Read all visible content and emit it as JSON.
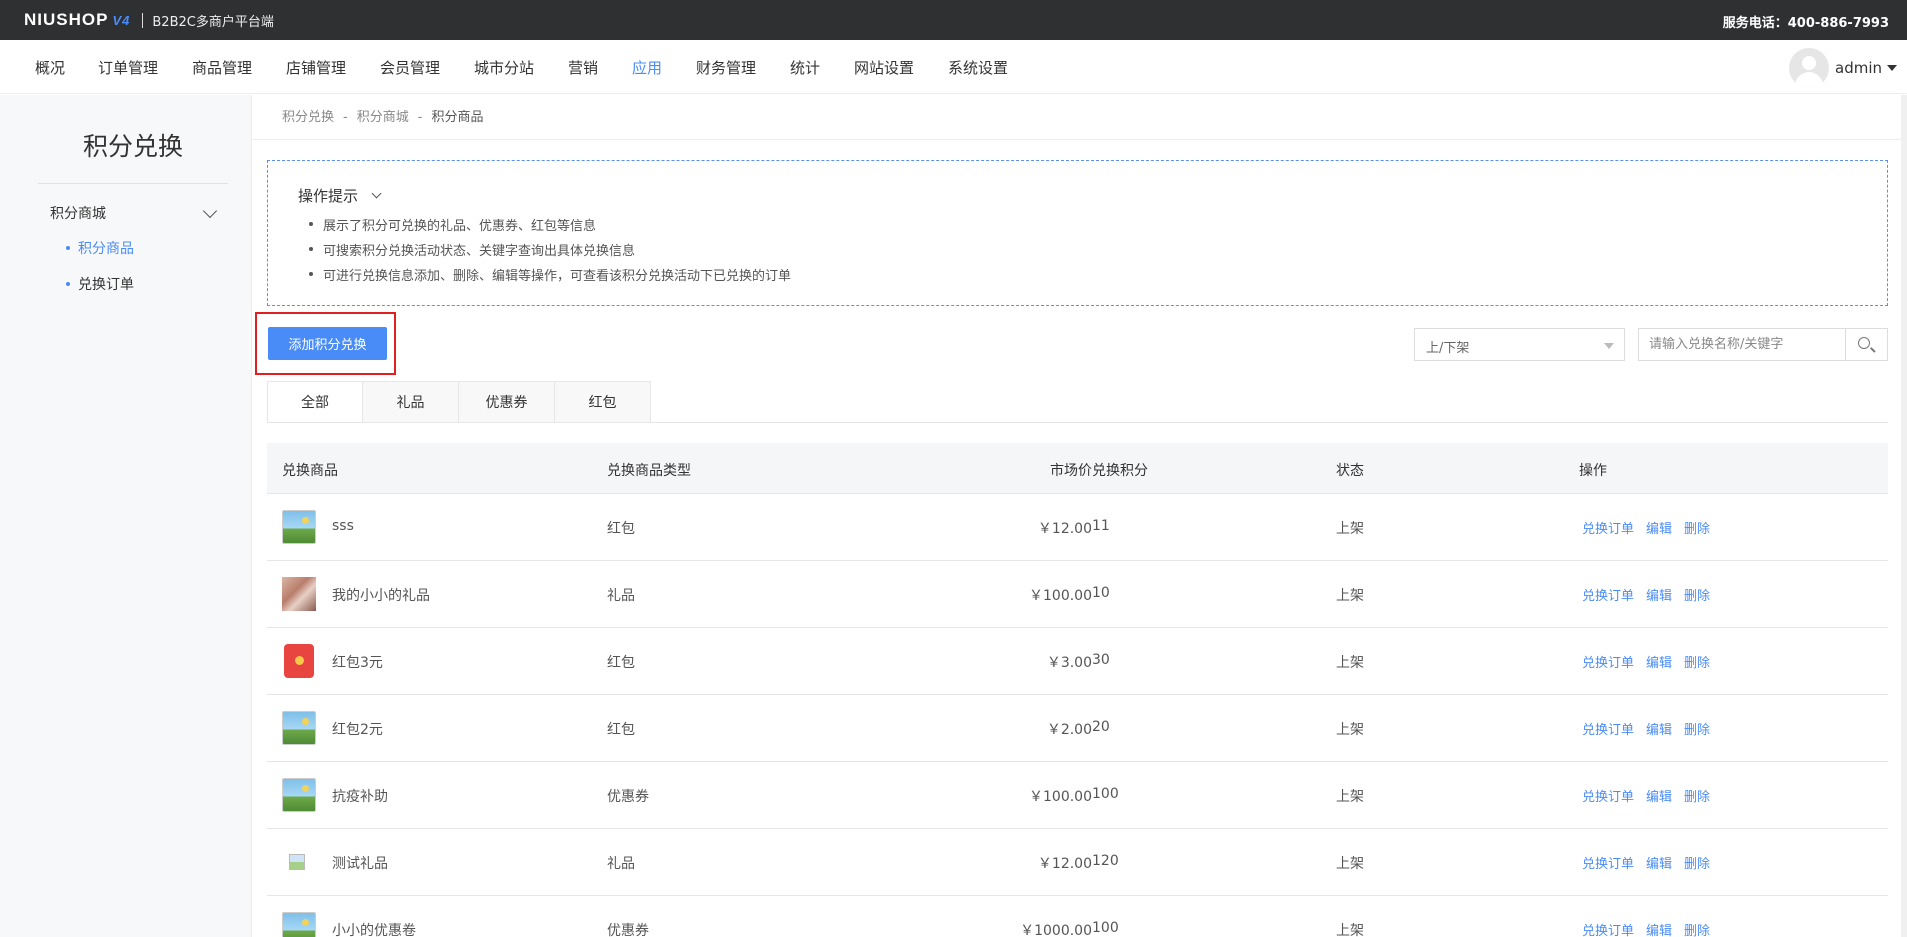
{
  "topbar": {
    "logo_main": "NIUSHOP",
    "logo_version": "V4",
    "subtitle": "B2B2C多商户平台端",
    "service": "服务电话：400-886-7993"
  },
  "nav": {
    "items": [
      "概况",
      "订单管理",
      "商品管理",
      "店铺管理",
      "会员管理",
      "城市分站",
      "营销",
      "应用",
      "财务管理",
      "统计",
      "网站设置",
      "系统设置"
    ],
    "active": "应用",
    "user": "admin"
  },
  "sidebar": {
    "title": "积分兑换",
    "group": "积分商城",
    "items": [
      "积分商品",
      "兑换订单"
    ],
    "active": "积分商品"
  },
  "breadcrumb": [
    "积分兑换",
    "积分商城",
    "积分商品"
  ],
  "tips": {
    "title": "操作提示",
    "items": [
      "展示了积分可兑换的礼品、优惠券、红包等信息",
      "可搜索积分兑换活动状态、关键字查询出具体兑换信息",
      "可进行兑换信息添加、删除、编辑等操作，可查看该积分兑换活动下已兑换的订单"
    ]
  },
  "actions": {
    "add_label": "添加积分兑换",
    "status_select": "上/下架",
    "search_placeholder": "请输入兑换名称/关键字"
  },
  "tabs": [
    "全部",
    "礼品",
    "优惠券",
    "红包"
  ],
  "table": {
    "headers": [
      "兑换商品",
      "兑换商品类型",
      "市场价",
      "兑换积分",
      "状态",
      "操作"
    ],
    "rows": [
      {
        "name": "sss",
        "type": "红包",
        "price": "￥12.00",
        "points": "11",
        "status": "上架",
        "thumb": "placeholder-image-icon"
      },
      {
        "name": "我的小小的礼品",
        "type": "礼品",
        "price": "￥100.00",
        "points": "10",
        "status": "上架",
        "thumb": "product-photo"
      },
      {
        "name": "红包3元",
        "type": "红包",
        "price": "￥3.00",
        "points": "30",
        "status": "上架",
        "thumb": "red-envelope-icon"
      },
      {
        "name": "红包2元",
        "type": "红包",
        "price": "￥2.00",
        "points": "20",
        "status": "上架",
        "thumb": "placeholder-image-icon"
      },
      {
        "name": "抗疫补助",
        "type": "优惠券",
        "price": "￥100.00",
        "points": "100",
        "status": "上架",
        "thumb": "placeholder-image-icon"
      },
      {
        "name": "测试礼品",
        "type": "礼品",
        "price": "￥12.00",
        "points": "120",
        "status": "上架",
        "thumb": "broken-image-icon"
      },
      {
        "name": "小小的优惠卷",
        "type": "优惠券",
        "price": "￥1000.00",
        "points": "100",
        "status": "上架",
        "thumb": "placeholder-image-icon"
      }
    ],
    "ops": [
      "兑换订单",
      "编辑",
      "删除"
    ]
  },
  "colors": {
    "accent": "#4a8cf7",
    "topbar": "#2f3032",
    "highlight_frame": "#e02020"
  }
}
